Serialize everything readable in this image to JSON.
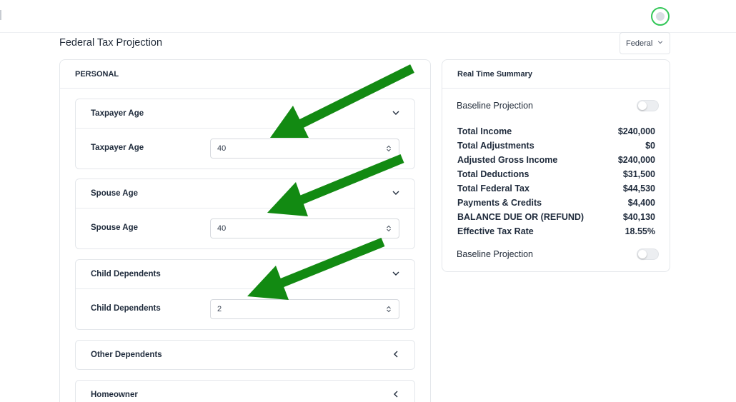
{
  "header": {
    "page_title": "Federal Tax Projection",
    "scope_select": {
      "value": "Federal"
    }
  },
  "personal": {
    "title": "PERSONAL",
    "sections": [
      {
        "title": "Taxpayer Age",
        "expanded": true,
        "field_label": "Taxpayer Age",
        "value": "40"
      },
      {
        "title": "Spouse Age",
        "expanded": true,
        "field_label": "Spouse Age",
        "value": "40"
      },
      {
        "title": "Child Dependents",
        "expanded": true,
        "field_label": "Child Dependents",
        "value": "2"
      },
      {
        "title": "Other Dependents",
        "expanded": false
      },
      {
        "title": "Homeowner",
        "expanded": false
      }
    ]
  },
  "summary": {
    "title": "Real Time Summary",
    "toggle_top_label": "Baseline Projection",
    "toggle_bottom_label": "Baseline Projection",
    "rows": [
      {
        "label": "Total Income",
        "value": "$240,000"
      },
      {
        "label": "Total Adjustments",
        "value": "$0"
      },
      {
        "label": "Adjusted Gross Income",
        "value": "$240,000"
      },
      {
        "label": "Total Deductions",
        "value": "$31,500"
      },
      {
        "label": "Total Federal Tax",
        "value": "$44,530"
      },
      {
        "label": "Payments & Credits",
        "value": "$4,400"
      },
      {
        "label": "BALANCE DUE OR (REFUND)",
        "value": "$40,130"
      },
      {
        "label": "Effective Tax Rate",
        "value": "18.55%"
      }
    ]
  },
  "colors": {
    "annotation_arrow": "#128a12",
    "avatar_ring": "#34c759"
  },
  "icons": [
    "user-avatar-icon",
    "chevron-down-icon",
    "chevron-left-icon",
    "spinner-icon",
    "annotation-arrow-icon"
  ]
}
